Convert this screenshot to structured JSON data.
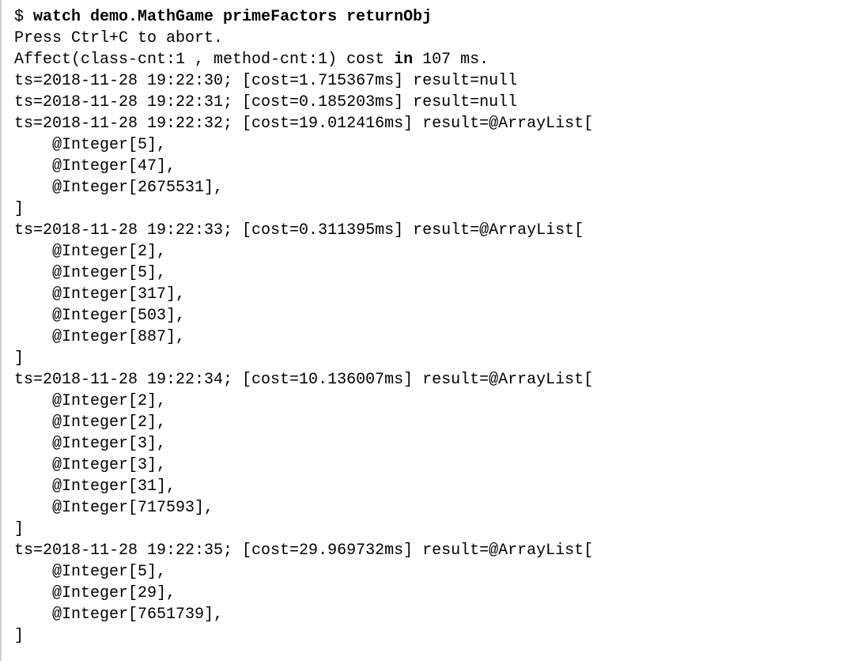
{
  "prompt": "$ ",
  "command": {
    "cmd": "watch demo.MathGame primeFactors returnObj",
    "abort_hint": "Press Ctrl+C to abort.",
    "affect_prefix": "Affect(class-cnt:1 , method-cnt:1) cost ",
    "affect_kw": "in",
    "affect_suffix": " 107 ms."
  },
  "entries": [
    {
      "ts": "2018-11-28 19:22:30",
      "cost": "1.715367ms",
      "result_type": "null",
      "items": []
    },
    {
      "ts": "2018-11-28 19:22:31",
      "cost": "0.185203ms",
      "result_type": "null",
      "items": []
    },
    {
      "ts": "2018-11-28 19:22:32",
      "cost": "19.012416ms",
      "result_type": "ArrayList",
      "items": [
        "5",
        "47",
        "2675531"
      ]
    },
    {
      "ts": "2018-11-28 19:22:33",
      "cost": "0.311395ms",
      "result_type": "ArrayList",
      "items": [
        "2",
        "5",
        "317",
        "503",
        "887"
      ]
    },
    {
      "ts": "2018-11-28 19:22:34",
      "cost": "10.136007ms",
      "result_type": "ArrayList",
      "items": [
        "2",
        "2",
        "3",
        "3",
        "31",
        "717593"
      ]
    },
    {
      "ts": "2018-11-28 19:22:35",
      "cost": "29.969732ms",
      "result_type": "ArrayList",
      "items": [
        "5",
        "29",
        "7651739"
      ]
    }
  ]
}
